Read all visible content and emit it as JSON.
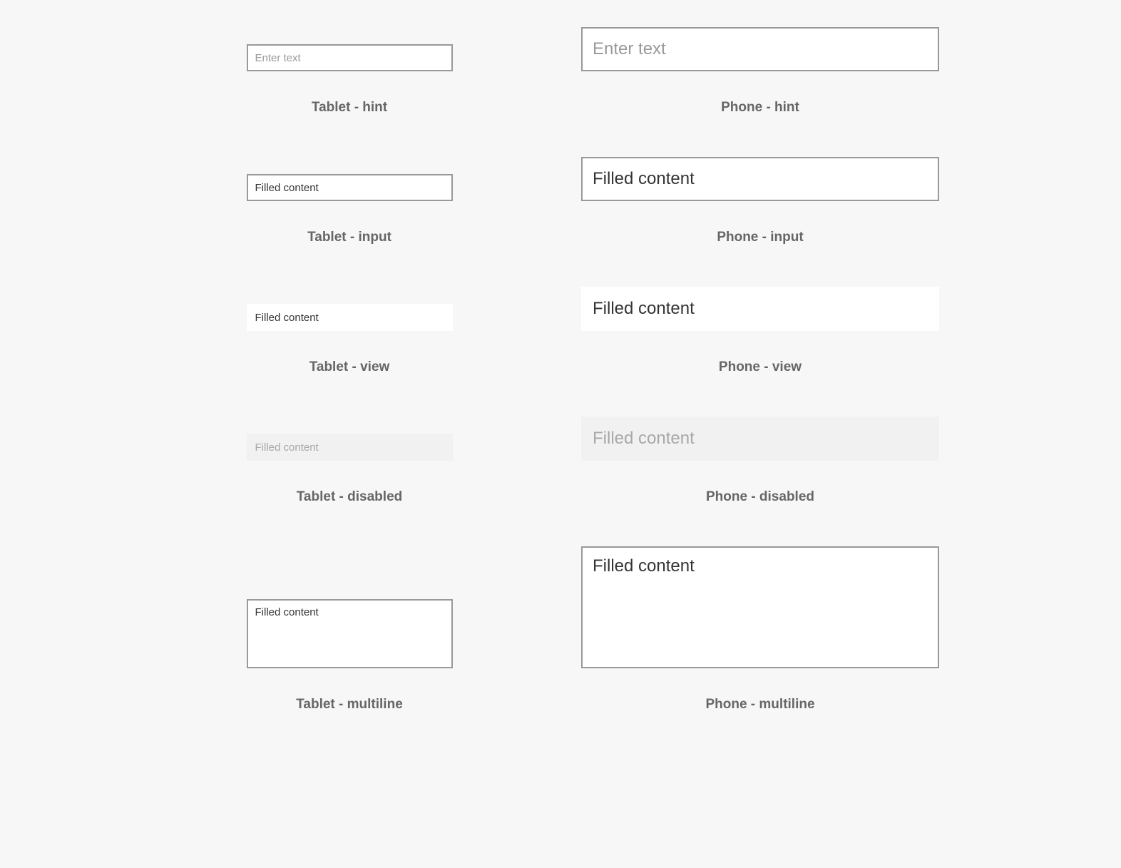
{
  "placeholder": "Enter text",
  "filled": "Filled content",
  "captions": {
    "tablet": {
      "hint": "Tablet - hint",
      "input": "Tablet - input",
      "view": "Tablet - view",
      "disabled": "Tablet - disabled",
      "multiline": "Tablet - multiline"
    },
    "phone": {
      "hint": "Phone - hint",
      "input": "Phone - input",
      "view": "Phone - view",
      "disabled": "Phone - disabled",
      "multiline": "Phone - multiline"
    }
  }
}
